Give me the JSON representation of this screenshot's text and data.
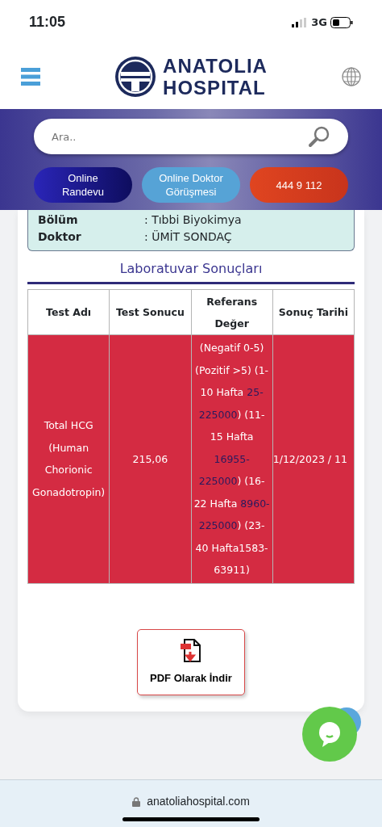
{
  "status_bar": {
    "time": "11:05",
    "network": "3G"
  },
  "header": {
    "logo_line1": "ANATOLIA",
    "logo_line2": "HOSPITAL"
  },
  "search": {
    "placeholder": "Ara.."
  },
  "action_buttons": [
    {
      "label_lines": [
        "Online",
        "Randevu"
      ],
      "kind": "dark"
    },
    {
      "label_lines": [
        "Online Doktor",
        "Görüşmesi"
      ],
      "kind": "light"
    },
    {
      "label_lines": [
        "444 9 112"
      ],
      "kind": "call"
    }
  ],
  "info": [
    {
      "label": "Bölüm",
      "value": ": Tıbbi Biyokimya"
    },
    {
      "label": "Doktor",
      "value": ": ÜMİT SONDAÇ"
    }
  ],
  "section_title": "Laboratuvar Sonuçları",
  "table": {
    "columns": [
      "Test Adı",
      "Test Sonucu",
      "Referans Değer",
      "Sonuç Tarihi"
    ],
    "rows": [
      {
        "test_name": "Total HCG (Human Chorionic Gonadotropin)",
        "result": "215,06",
        "reference": [
          {
            "text": "(Negatif 0-5) (Pozitif >5) (1-10 Hafta ",
            "kind": "plain"
          },
          {
            "text": "25-225000",
            "kind": "link"
          },
          {
            "text": ") (11-15 Hafta ",
            "kind": "plain"
          },
          {
            "text": "16955-225000",
            "kind": "link"
          },
          {
            "text": ") (16-22 Hafta ",
            "kind": "plain"
          },
          {
            "text": "8960-225000",
            "kind": "link"
          },
          {
            "text": ") (23-40 Hafta1583-63911)",
            "kind": "plain"
          }
        ],
        "date": "1/12/2023 / 11"
      }
    ]
  },
  "pdf_button": {
    "label": "PDF Olarak İndir"
  },
  "browser": {
    "url": "anatoliahospital.com"
  }
}
